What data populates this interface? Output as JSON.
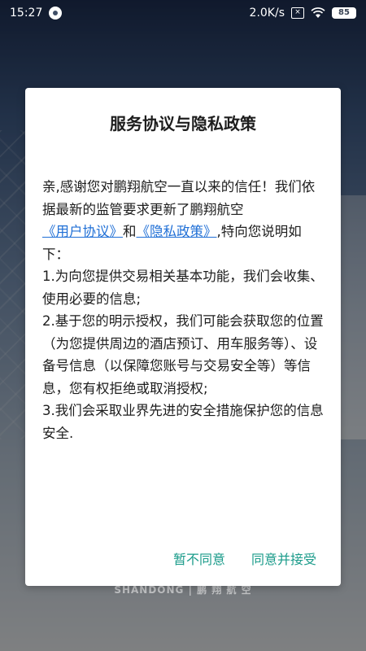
{
  "status_bar": {
    "time": "15:27",
    "network_speed": "2.0K/s",
    "battery": "85",
    "icons": [
      "q-app-icon",
      "sim-x-icon",
      "wifi-icon",
      "battery-icon"
    ]
  },
  "dialog": {
    "title": "服务协议与隐私政策",
    "intro_part1": "亲,感谢您对鹏翔航空一直以来的信任！我们依据最新的监管要求更新了鹏翔航空",
    "user_agreement_link": "《用户协议》",
    "and_text": "和",
    "privacy_policy_link": "《隐私政策》",
    "intro_part2": ",特向您说明如下：",
    "point1": "1.为向您提供交易相关基本功能，我们会收集、使用必要的信息;",
    "point2": "2.基于您的明示授权，我们可能会获取您的位置（为您提供周边的酒店预订、用车服务等）、设备号信息（以保障您账号与交易安全等）等信息，您有权拒绝或取消授权;",
    "point3": "3.我们会采取业界先进的安全措施保护您的信息安全.",
    "decline_button": "暂不同意",
    "accept_button": "同意并接受"
  },
  "background": {
    "brand_text": "SHANDONG | 鹏 翔 航 空"
  },
  "colors": {
    "link": "#1f6fd6",
    "action": "#1a9b8a",
    "dialog_bg": "#ffffff",
    "text": "#1d1d1d"
  }
}
